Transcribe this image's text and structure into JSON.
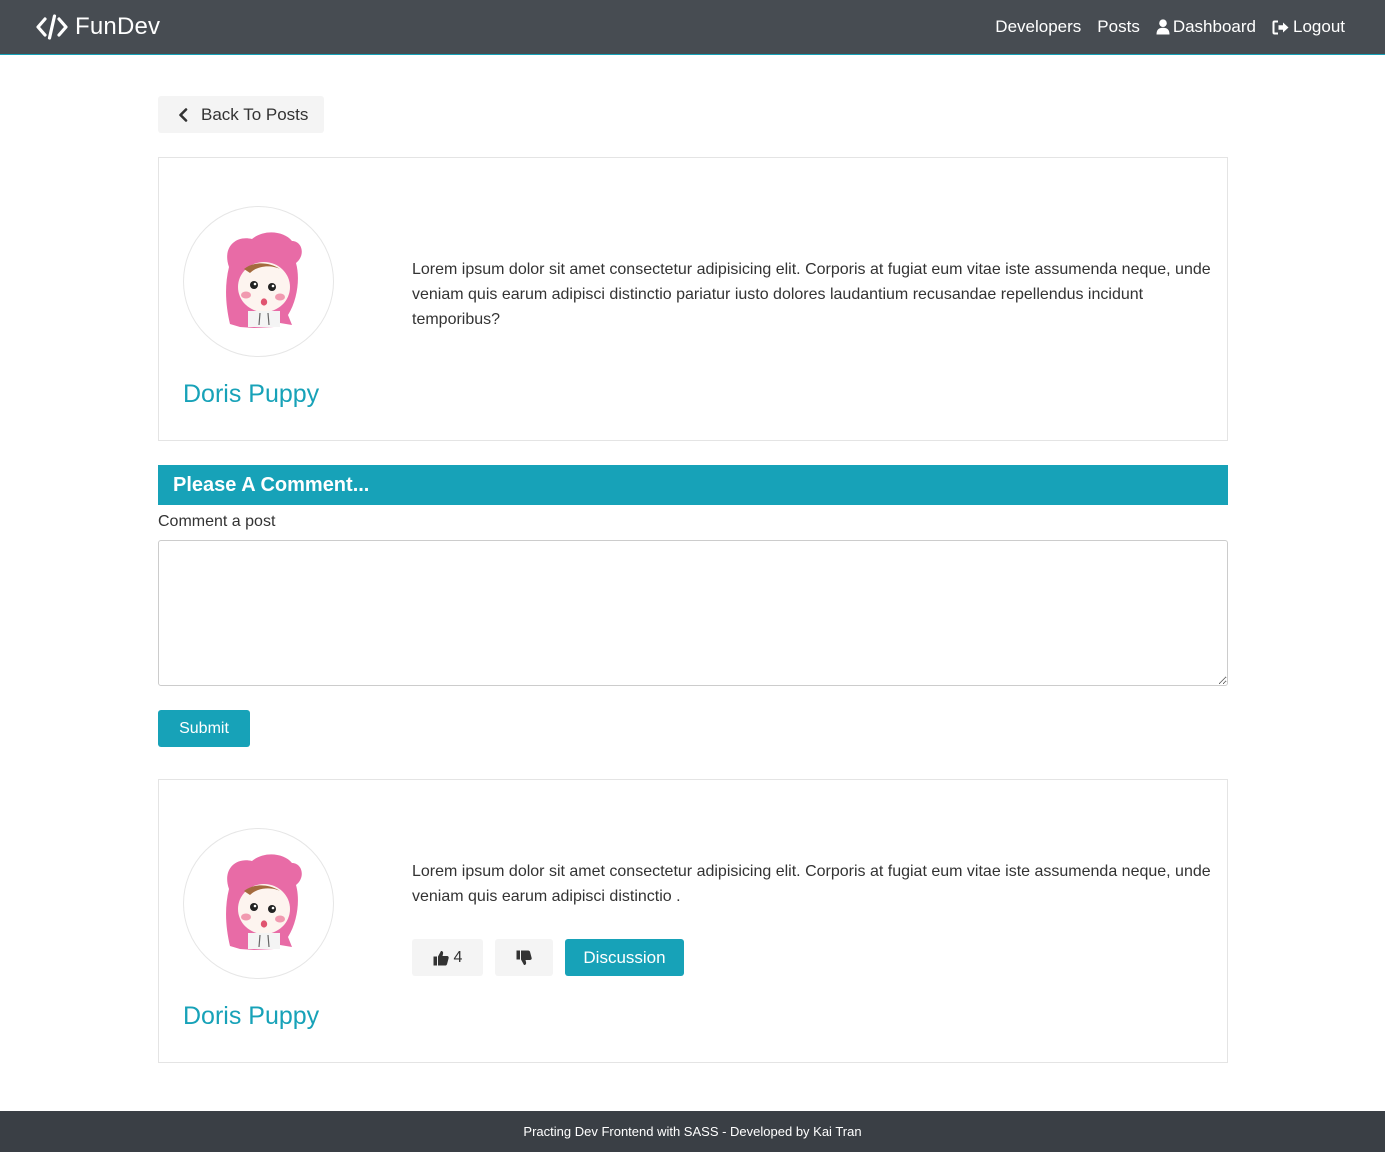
{
  "navbar": {
    "brand": "FunDev",
    "links": [
      {
        "label": "Developers"
      },
      {
        "label": "Posts"
      },
      {
        "label": "Dashboard",
        "icon": "user-icon"
      },
      {
        "label": "Logout",
        "icon": "sign-out-icon"
      }
    ]
  },
  "back_button": {
    "label": "Back To Posts",
    "icon": "chevron-left-icon"
  },
  "post": {
    "author": "Doris Puppy",
    "text": "Lorem ipsum dolor sit amet consectetur adipisicing elit. Corporis at fugiat eum vitae iste assumenda neque, unde veniam quis earum adipisci distinctio pariatur iusto dolores laudantium recusandae repellendus incidunt temporibus?"
  },
  "comment_form": {
    "header": "Please A Comment...",
    "label": "Comment a post",
    "textarea_value": "",
    "submit_label": "Submit"
  },
  "comments": [
    {
      "author": "Doris Puppy",
      "text": "Lorem ipsum dolor sit amet consectetur adipisicing elit. Corporis at fugiat eum vitae iste assumenda neque, unde veniam quis earum adipisci distinctio .",
      "likes": "4",
      "discussion_label": "Discussion"
    }
  ],
  "footer": {
    "text": "Practing Dev Frontend with SASS - Developed by Kai Tran"
  },
  "colors": {
    "accent": "#17a2b8",
    "navbar": "#474c52",
    "footer": "#3a3f45"
  }
}
